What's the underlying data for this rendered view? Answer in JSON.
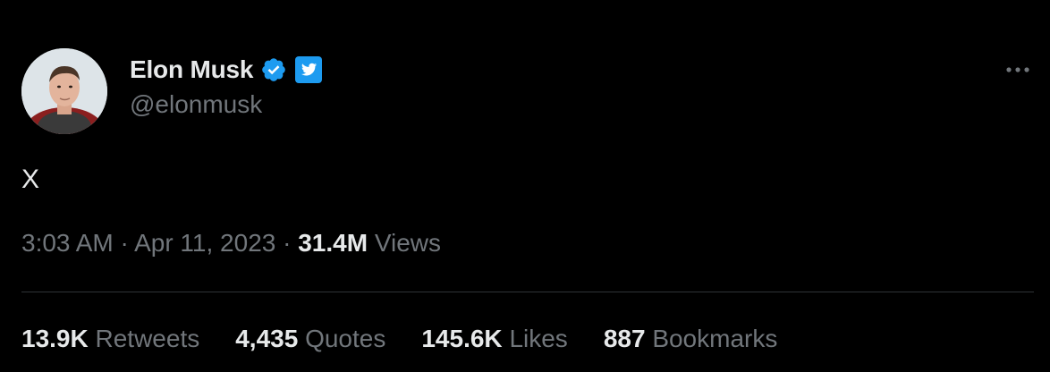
{
  "author": {
    "display_name": "Elon Musk",
    "handle": "@elonmusk",
    "avatar_icon": "profile-photo",
    "badges": [
      "verified-icon",
      "twitter-badge-icon"
    ]
  },
  "menu": {
    "icon": "more-horizontal-icon"
  },
  "tweet": {
    "text": "X"
  },
  "meta": {
    "time": "3:03 AM",
    "separator": " · ",
    "date": "Apr 11, 2023",
    "views_count": "31.4M",
    "views_label": "Views"
  },
  "stats": [
    {
      "count": "13.9K",
      "label": "Retweets"
    },
    {
      "count": "4,435",
      "label": "Quotes"
    },
    {
      "count": "145.6K",
      "label": "Likes"
    },
    {
      "count": "887",
      "label": "Bookmarks"
    }
  ],
  "colors": {
    "background": "#000000",
    "primary_text": "#e7e9ea",
    "secondary_text": "#71767b",
    "divider": "#2f3336",
    "verified_blue": "#1d9bf0"
  }
}
